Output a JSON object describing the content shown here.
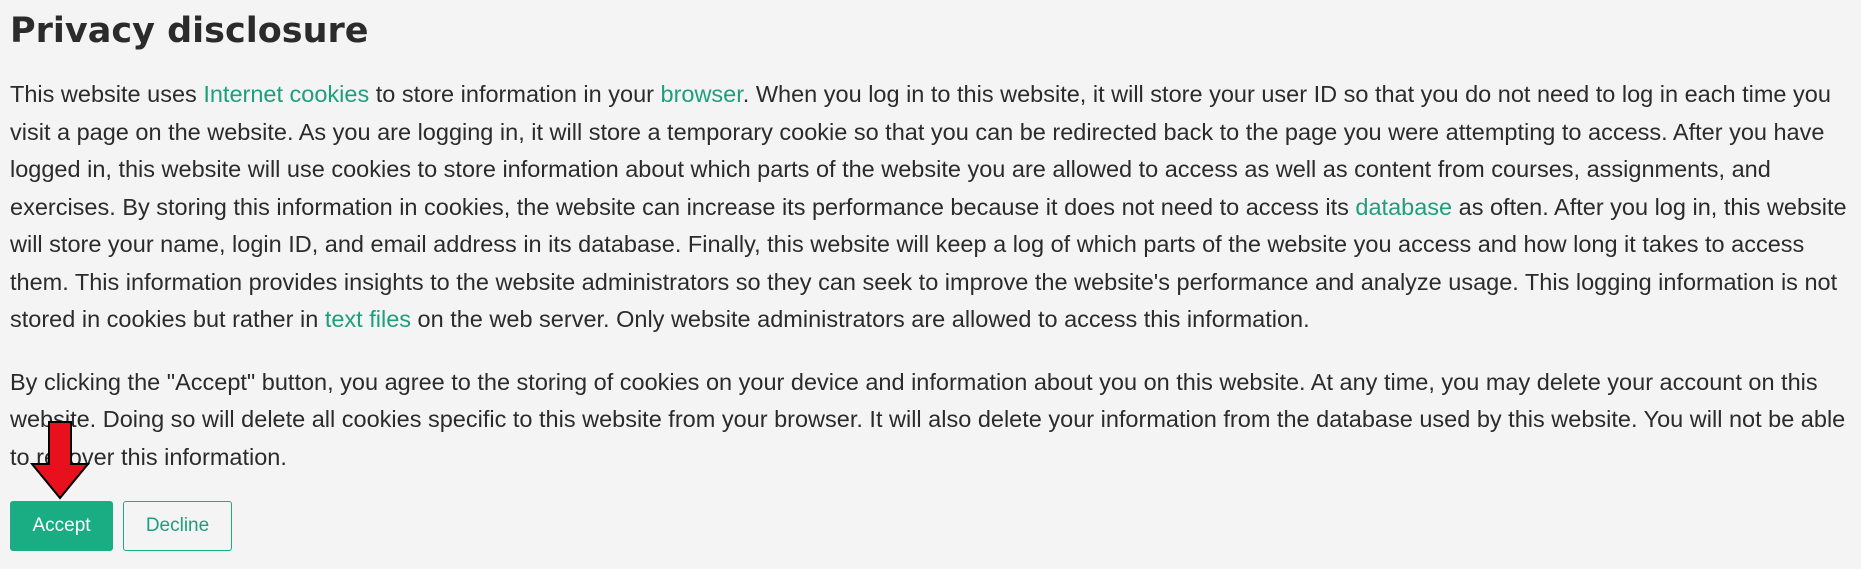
{
  "page": {
    "title": "Privacy disclosure"
  },
  "paragraph1": {
    "t1": "This website uses ",
    "link1": "Internet cookies",
    "t2": " to store information in your ",
    "link2": "browser",
    "t3": ". When you log in to this website, it will store your user ID so that you do not need to log in each time you visit a page on the website. As you are logging in, it will store a temporary cookie so that you can be redirected back to the page you were attempting to access. After you have logged in, this website will use cookies to store information about which parts of the website you are allowed to access as well as content from courses, assignments, and exercises. By storing this information in cookies, the website can increase its performance because it does not need to access its ",
    "link3": "database",
    "t4": " as often. After you log in, this website will store your name, login ID, and email address in its database. Finally, this website will keep a log of which parts of the website you access and how long it takes to access them. This information provides insights to the website administrators so they can seek to improve the website's performance and analyze usage. This logging information is not stored in cookies but rather in ",
    "link4": "text files",
    "t5": " on the web server. Only website administrators are allowed to access this information."
  },
  "paragraph2": {
    "text": "By clicking the \"Accept\" button, you agree to the storing of cookies on your device and information about you on this website. At any time, you may delete your account on this website. Doing so will delete all cookies specific to this website from your browser. It will also delete your information from the database used by this website. You will not be able to recover this information."
  },
  "buttons": {
    "accept_label": "Accept",
    "decline_label": "Decline"
  },
  "colors": {
    "accent": "#1aac82",
    "link": "#1d9e7c",
    "annotation_arrow": "#e8101c"
  },
  "icons": {
    "annotation": "red-down-arrow-icon"
  }
}
